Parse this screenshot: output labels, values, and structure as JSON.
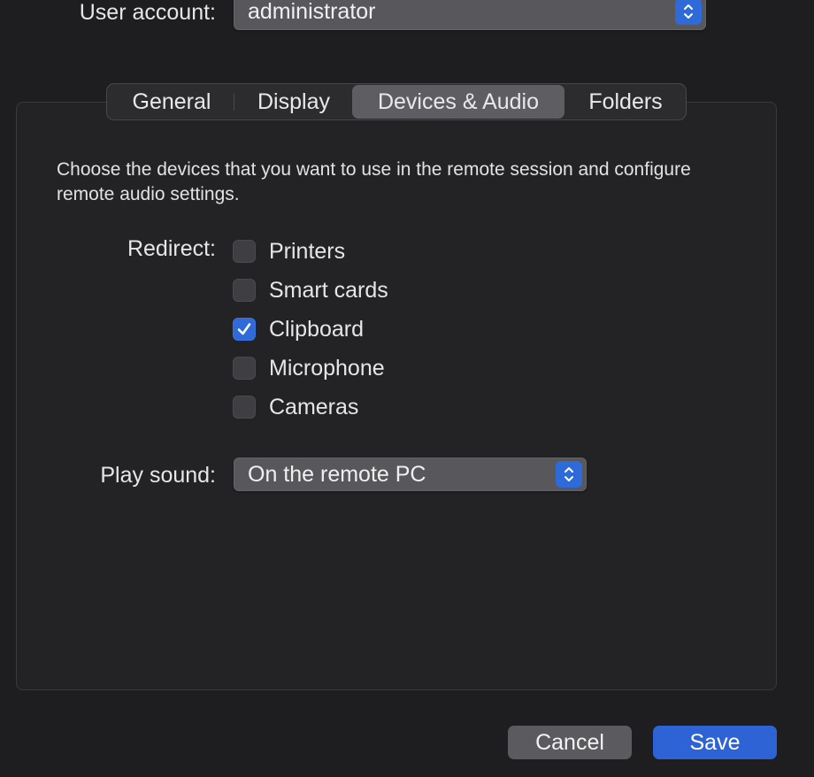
{
  "user_account": {
    "label": "User account:",
    "value": "administrator"
  },
  "tabs": [
    {
      "label": "General",
      "active": false
    },
    {
      "label": "Display",
      "active": false
    },
    {
      "label": "Devices & Audio",
      "active": true
    },
    {
      "label": "Folders",
      "active": false
    }
  ],
  "description": "Choose the devices that you want to use in the remote session and configure remote audio settings.",
  "redirect": {
    "label": "Redirect:",
    "options": [
      {
        "label": "Printers",
        "checked": false
      },
      {
        "label": "Smart cards",
        "checked": false
      },
      {
        "label": "Clipboard",
        "checked": true
      },
      {
        "label": "Microphone",
        "checked": false
      },
      {
        "label": "Cameras",
        "checked": false
      }
    ]
  },
  "play_sound": {
    "label": "Play sound:",
    "value": "On the remote PC"
  },
  "buttons": {
    "cancel": "Cancel",
    "save": "Save"
  },
  "colors": {
    "accent": "#2f6ad9",
    "background": "#1e1e20",
    "panel": "#232326"
  }
}
